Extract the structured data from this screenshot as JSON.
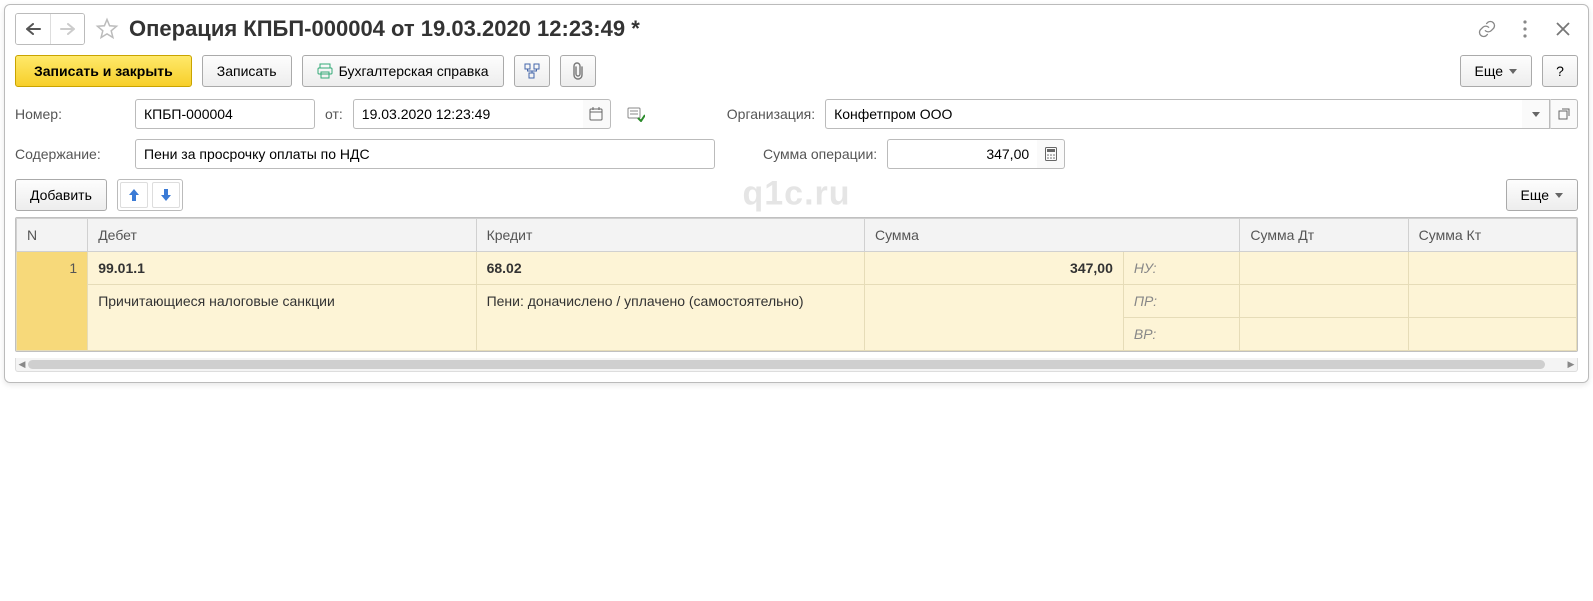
{
  "title": "Операция КПБП-000004 от 19.03.2020 12:23:49 *",
  "toolbar": {
    "save_close": "Записать и закрыть",
    "save": "Записать",
    "accounting_note": "Бухгалтерская справка",
    "more": "Еще",
    "help": "?"
  },
  "form": {
    "number_label": "Номер:",
    "number_value": "КПБП-000004",
    "date_label": "от:",
    "date_value": "19.03.2020 12:23:49",
    "org_label": "Организация:",
    "org_value": "Конфетпром ООО",
    "desc_label": "Содержание:",
    "desc_value": "Пени за просрочку оплаты по НДС",
    "sum_label": "Сумма операции:",
    "sum_value": "347,00"
  },
  "table_toolbar": {
    "add": "Добавить",
    "more": "Еще"
  },
  "grid": {
    "headers": {
      "n": "N",
      "debit": "Дебет",
      "credit": "Кредит",
      "sum": "Сумма",
      "sum_dt": "Сумма Дт",
      "sum_kt": "Сумма Кт"
    },
    "rows": [
      {
        "n": "1",
        "debit_account": "99.01.1",
        "debit_analytic": "Причитающиеся налоговые санкции",
        "credit_account": "68.02",
        "credit_analytic": "Пени: доначислено / уплачено (самостоятельно)",
        "sum": "347,00",
        "sublabels": [
          "НУ:",
          "ПР:",
          "ВР:"
        ]
      }
    ]
  },
  "watermark": "q1c.ru"
}
